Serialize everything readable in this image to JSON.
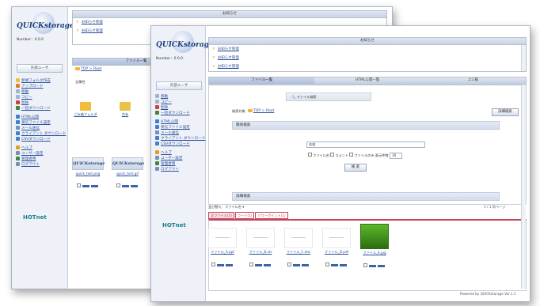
{
  "sidebar": {
    "logo": "QUICKstorage",
    "ip_text": "Number：0.0.0",
    "top_button": "外部ユーザ",
    "items_back": [
      "新規フォルダ作成",
      "アップロード",
      "移動",
      "コピー",
      "削除",
      "一括ダウンロード",
      "HTML公開",
      "受信ファイル設定",
      "メール送信",
      "クライアント ダウンロード",
      "CSVダウンロード",
      "ヘルプ",
      "ユーザー設定",
      "管理者用",
      "ログアウト"
    ],
    "items_front": [
      "移動",
      "コピー",
      "削除",
      "一括ダウンロード",
      "HTML公開",
      "受信ファイル設定",
      "メール送信",
      "クライアント ダウンロード",
      "CSVダウンロード",
      "ヘルプ",
      "ユーザー設定",
      "管理者用",
      "ログアウト"
    ],
    "brand": "HOTnet"
  },
  "notice": {
    "title": "お知らせ",
    "rows": [
      "お知らせ管理",
      "お知らせ管理",
      "お知らせ管理"
    ]
  },
  "back_window": {
    "tabs": [
      "ファイル一覧"
    ],
    "breadcrumb": "TOP > Root",
    "folder_label": "全属性",
    "items": [
      {
        "name": "ごみ箱フォルダ",
        "kind": "folder"
      },
      {
        "name": "共有",
        "kind": "folder"
      },
      {
        "name": "quick_test.png",
        "kind": "thumb"
      },
      {
        "name": "quick_test.gif",
        "kind": "thumb"
      }
    ]
  },
  "front_window": {
    "tabs": [
      "ファイル一覧",
      "HTML公開一覧",
      "ゴミ箱"
    ],
    "search_title": "ファイル検索",
    "search_target_label": "検索対象",
    "breadcrumb": "TOP > Root",
    "detail_button": "詳細検索",
    "simple_search_header": "簡易検索",
    "query_value": "名前",
    "option_filename": "ファイル名",
    "option_comment": "コメント",
    "option_files": "ファイルのみ",
    "per_page_label": "表示件数",
    "per_page_value": "10",
    "search_button": "検 索",
    "detail_header": "詳細検索",
    "sort_label": "並び替え",
    "sort_value": "ファイル名",
    "pager": "1 / 1 再ページ",
    "file_tabs": [
      "全ファイル(5)",
      "ワード(1)",
      "パワーポイント(1)"
    ],
    "files": [
      {
        "name": "ファイル_A.ppt",
        "thumb": "blank"
      },
      {
        "name": "ファイル_B.xls",
        "thumb": "blank"
      },
      {
        "name": "ファイル_C.doc",
        "thumb": "blank"
      },
      {
        "name": "ファイル_D.pdf",
        "thumb": "blank"
      },
      {
        "name": "ファイル_E.jpg",
        "thumb": "green"
      }
    ],
    "footer": "Powered by QUICKstorage Ver.1.1"
  }
}
